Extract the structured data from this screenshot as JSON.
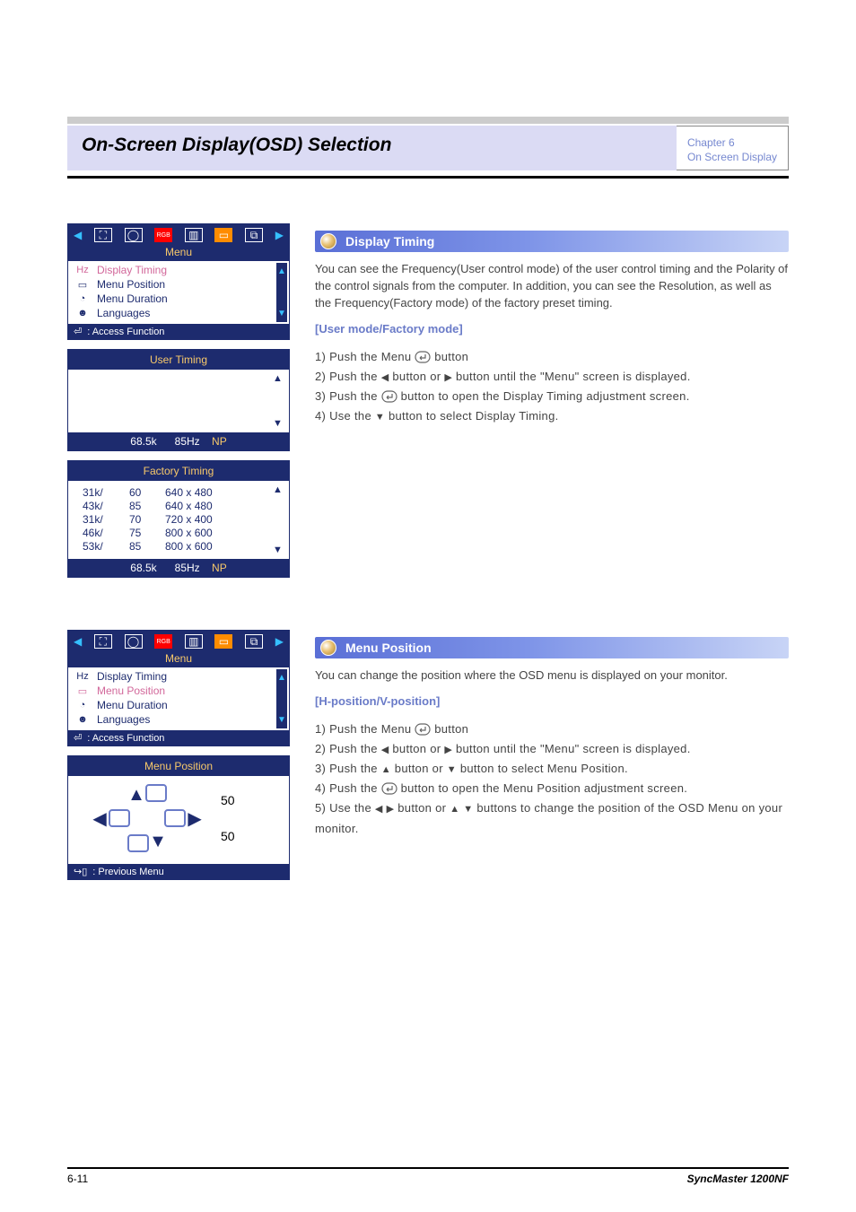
{
  "header": {
    "title": "On-Screen Display(OSD) Selection",
    "tab_lines": [
      "Chapter 6",
      "On Screen Display"
    ]
  },
  "sections": {
    "display_timing": {
      "header": "Display Timing",
      "intro": "You can see the Frequency(User control mode) of the user control timing and the Polarity of the control signals from the computer. In addition, you can see the Resolution, as well as the Frequency(Factory mode) of the factory preset timing.",
      "subtitle": "[User mode/Factory mode]",
      "steps": [
        "1) Push the Menu ~ENTER~ button",
        "2) Push the ~LEFT~ button or ~RIGHT~ button until the \"Menu\" screen is displayed.",
        "3) Push the ~ENTER~ button to open the Display Timing adjustment screen.",
        "4) Use the ~DOWN~ button to select Display Timing."
      ]
    },
    "menu_position": {
      "header": "Menu Position",
      "intro": "You can change the position where the OSD menu is displayed on your monitor.",
      "subtitle": "[H-position/V-position]",
      "steps": [
        "1) Push the Menu ~ENTER~ button",
        "2) Push the ~LEFT~ button or ~RIGHT~ button until the \"Menu\" screen is displayed.",
        "3) Push the ~UP~ button or ~DOWN~ button to select Menu Position.",
        "4) Push the ~ENTER~ button to open the Menu Position adjustment screen.",
        "5) Use the ~LEFT~ ~RIGHT~ button or ~UP~ ~DOWN~ buttons to change the position of the OSD Menu on your monitor."
      ]
    }
  },
  "osd": {
    "menu_title": "Menu",
    "items": [
      "Display Timing",
      "Menu Position",
      "Menu Duration",
      "Languages"
    ],
    "footer_access": ": Access Function",
    "footer_prev": ": Previous Menu",
    "user_timing_title": "User Timing",
    "factory_timing_title": "Factory Timing",
    "timing_status": {
      "freq": "68.5k",
      "rate": "85Hz",
      "pol": "NP"
    },
    "factory_rows": [
      {
        "k": "31k/",
        "hz": "60",
        "res": "640 x 480"
      },
      {
        "k": "43k/",
        "hz": "85",
        "res": "640 x 480"
      },
      {
        "k": "31k/",
        "hz": "70",
        "res": "720 x 400"
      },
      {
        "k": "46k/",
        "hz": "75",
        "res": "800 x 600"
      },
      {
        "k": "53k/",
        "hz": "85",
        "res": "800 x 600"
      }
    ],
    "menu_position_title": "Menu Position",
    "menu_position_values": {
      "h": "50",
      "v": "50"
    }
  },
  "footer": {
    "left": "6-11",
    "right": "SyncMaster 1200NF"
  }
}
